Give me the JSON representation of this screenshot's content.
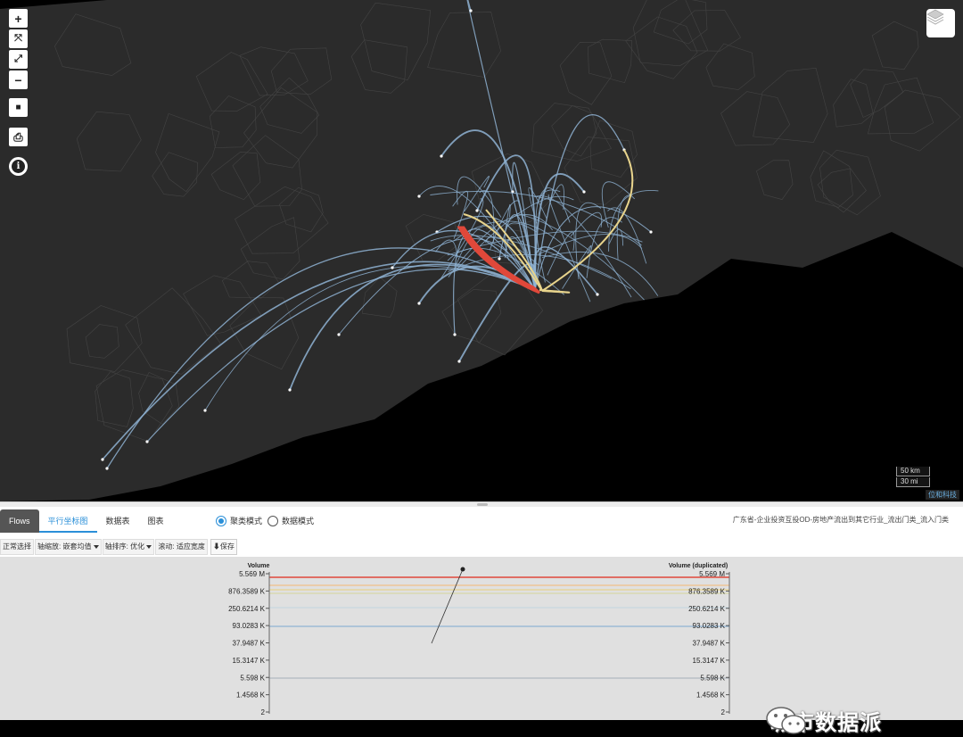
{
  "map": {
    "controls": [
      {
        "name": "zoom-in",
        "glyph": "+"
      },
      {
        "name": "fit-extent",
        "glyph": "⤧"
      },
      {
        "name": "fullscreen",
        "glyph": "⤢"
      },
      {
        "name": "zoom-out",
        "glyph": "−"
      },
      {
        "name": "stop",
        "glyph": "■"
      },
      {
        "name": "export",
        "glyph": "⎙"
      },
      {
        "name": "info",
        "glyph": "i"
      }
    ],
    "scale_km": "50 km",
    "scale_mi": "30 mi",
    "attribution": "位和科技",
    "colors": {
      "low": "#8fb3d3",
      "mid": "#e8d48c",
      "high": "#e0483a"
    }
  },
  "panel": {
    "tabs": [
      {
        "label": "Flows",
        "state": "active"
      },
      {
        "label": "平行坐标图",
        "state": "selected"
      },
      {
        "label": "数据表",
        "state": "normal"
      },
      {
        "label": "图表",
        "state": "normal"
      }
    ],
    "modes": [
      {
        "label": "聚类模式",
        "checked": true
      },
      {
        "label": "数据模式",
        "checked": false
      }
    ],
    "title": "广东省-企业投资互投OD-房地产流出到其它行业_流出门类_流入门类",
    "toolbar": {
      "select": "正常选择",
      "axis_scale": "轴缩放: 嵌套均值",
      "axis_sort": "轴排序: 优化",
      "scroll": "滚动: 适应宽度",
      "save": "保存"
    }
  },
  "parallel_coords": {
    "left_axis_title": "Volume",
    "right_axis_title": "Volume (duplicated)",
    "ticks": [
      "5.569 M",
      "876.3589 K",
      "250.6214 K",
      "93.0283 K",
      "37.9487 K",
      "15.3147 K",
      "5.598 K",
      "1.4568 K",
      "2"
    ],
    "line_colors": [
      "#e0483a",
      "#f0c08a",
      "#e8d48c",
      "#d8d8a8",
      "#c8d8e0",
      "#8fb3d3",
      "#b0b8c0"
    ]
  },
  "watermark": {
    "text": "城市数据派"
  }
}
